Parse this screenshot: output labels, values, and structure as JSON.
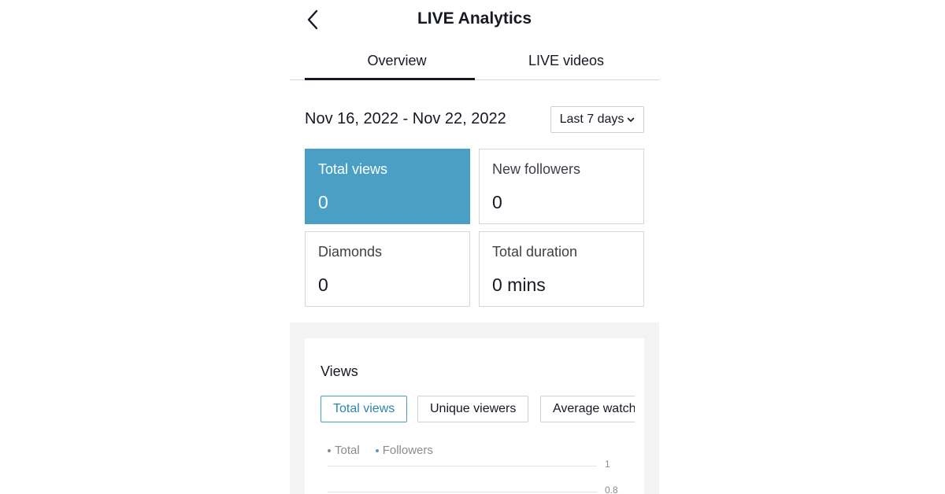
{
  "header": {
    "title": "LIVE Analytics",
    "back_icon": "chevron-left-icon"
  },
  "tabs": [
    {
      "label": "Overview",
      "active": true
    },
    {
      "label": "LIVE videos",
      "active": false
    }
  ],
  "date_range": "Nov 16, 2022 - Nov 22, 2022",
  "period_select": {
    "value": "Last 7 days",
    "icon": "chevron-down-icon"
  },
  "stats": [
    {
      "label": "Total views",
      "value": "0",
      "active": true
    },
    {
      "label": "New followers",
      "value": "0",
      "active": false
    },
    {
      "label": "Diamonds",
      "value": "0",
      "active": false
    },
    {
      "label": "Total duration",
      "value": "0 mins",
      "active": false
    }
  ],
  "views_section": {
    "title": "Views",
    "chips": [
      {
        "label": "Total views",
        "active": true
      },
      {
        "label": "Unique viewers",
        "active": false
      },
      {
        "label": "Average watch",
        "active": false
      }
    ],
    "legend": [
      {
        "label": "Total",
        "color": "#8a8b91"
      },
      {
        "label": "Followers",
        "color": "#4aa0c4"
      }
    ],
    "y_ticks": [
      "1",
      "0.8"
    ]
  },
  "colors": {
    "accent": "#4aa0c4",
    "text": "#161823",
    "muted": "#8a8b91"
  }
}
